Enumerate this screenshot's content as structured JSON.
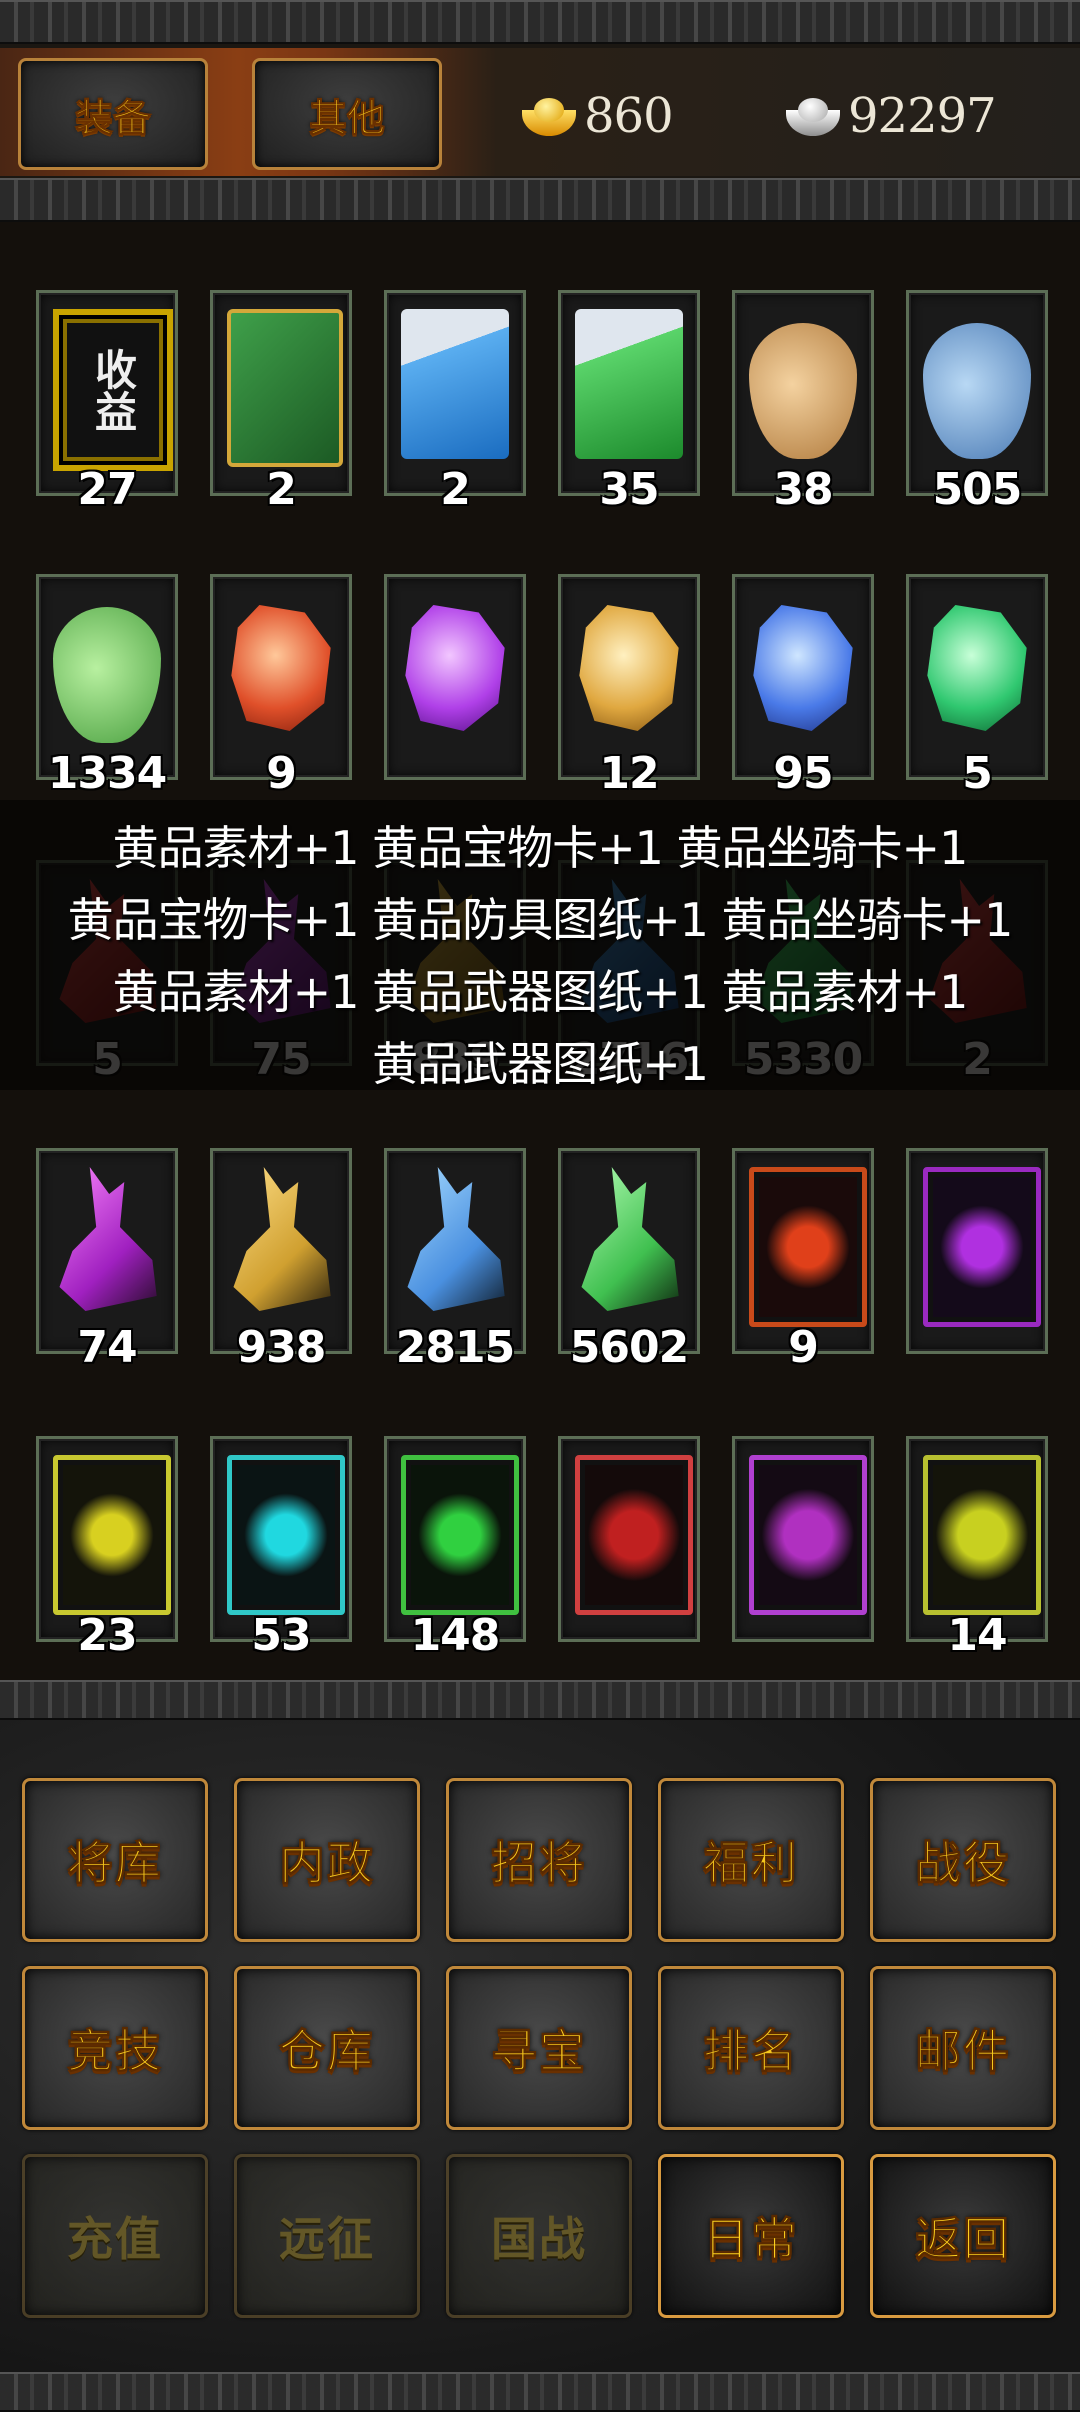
{
  "tabs": [
    {
      "label": "装备"
    },
    {
      "label": "其他"
    }
  ],
  "currency": {
    "gold": "860",
    "silver": "92297",
    "gold_icon": "gold-ingot-icon",
    "silver_icon": "silver-ingot-icon"
  },
  "items": [
    {
      "count": "27",
      "icon": "shouyi-plaque-icon"
    },
    {
      "count": "2",
      "icon": "green-chest-icon"
    },
    {
      "count": "2",
      "icon": "blue-gem-box-icon"
    },
    {
      "count": "35",
      "icon": "green-gem-box-icon"
    },
    {
      "count": "38",
      "icon": "tan-bag-icon"
    },
    {
      "count": "505",
      "icon": "blue-bag-icon"
    },
    {
      "count": "1334",
      "icon": "green-bag-icon"
    },
    {
      "count": "9",
      "icon": "red-ore-icon"
    },
    {
      "count": "",
      "icon": "purple-ore-icon"
    },
    {
      "count": "12",
      "icon": "gold-ore-icon"
    },
    {
      "count": "95",
      "icon": "blue-ore-icon"
    },
    {
      "count": "5",
      "icon": "green-ore-icon"
    },
    {
      "count": "5",
      "icon": "red-scroll-icon"
    },
    {
      "count": "75",
      "icon": "purple-scroll-icon"
    },
    {
      "count": "839",
      "icon": "gold-scroll-icon"
    },
    {
      "count": "2716",
      "icon": "blue-scroll-icon"
    },
    {
      "count": "5330",
      "icon": "green-scroll-icon"
    },
    {
      "count": "2",
      "icon": "red-scroll-icon"
    },
    {
      "count": "74",
      "icon": "purple-blueprint-icon"
    },
    {
      "count": "938",
      "icon": "gold-blueprint-icon"
    },
    {
      "count": "2815",
      "icon": "blue-blueprint-icon"
    },
    {
      "count": "5602",
      "icon": "green-blueprint-icon"
    },
    {
      "count": "9",
      "icon": "red-horse-card-icon"
    },
    {
      "count": "",
      "icon": "purple-horse-card-icon"
    },
    {
      "count": "23",
      "icon": "yellow-horse-card-icon"
    },
    {
      "count": "53",
      "icon": "cyan-horse-card-icon"
    },
    {
      "count": "148",
      "icon": "green-horse-card-icon"
    },
    {
      "count": "",
      "icon": "red-treasure-card-icon"
    },
    {
      "count": "",
      "icon": "purple-treasure-card-icon"
    },
    {
      "count": "14",
      "icon": "yellow-treasure-card-icon"
    }
  ],
  "loot_overlay": {
    "lines": [
      "黄品素材+1 黄品宝物卡+1 黄品坐骑卡+1",
      "黄品宝物卡+1 黄品防具图纸+1 黄品坐骑卡+1",
      "黄品素材+1 黄品武器图纸+1 黄品素材+1",
      "黄品武器图纸+1"
    ]
  },
  "menu": [
    {
      "label": "将库"
    },
    {
      "label": "内政"
    },
    {
      "label": "招将"
    },
    {
      "label": "福利"
    },
    {
      "label": "战役"
    },
    {
      "label": "竞技"
    },
    {
      "label": "仓库"
    },
    {
      "label": "寻宝"
    },
    {
      "label": "排名"
    },
    {
      "label": "邮件"
    },
    {
      "label": "充值"
    },
    {
      "label": "远征"
    },
    {
      "label": "国战"
    },
    {
      "label": "日常"
    },
    {
      "label": "返回"
    }
  ]
}
